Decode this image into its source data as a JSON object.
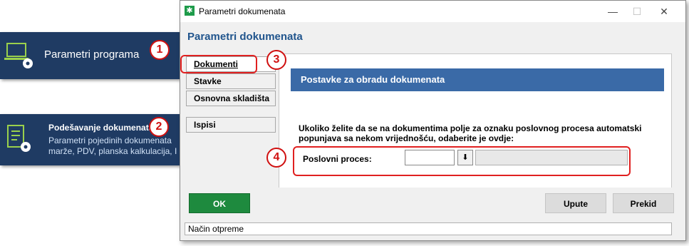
{
  "tiles": {
    "program_params": {
      "label": "Parametri programa"
    },
    "doc_settings": {
      "title": "Podešavanje dokumenata",
      "desc_line1": "Parametri pojedinih dokumenata",
      "desc_line2": "marže, PDV, planska kalkulacija, I"
    }
  },
  "callouts": [
    "1",
    "2",
    "3",
    "4"
  ],
  "window": {
    "title": "Parametri dokumenata",
    "page_title": "Parametri dokumenata",
    "controls": {
      "minimize": "—",
      "maximize": "☐",
      "close": "✕"
    }
  },
  "tabs": [
    {
      "label": "Dokumenti",
      "active": true
    },
    {
      "label": "Stavke",
      "active": false
    },
    {
      "label": "Osnovna skladišta",
      "active": false
    },
    {
      "label": "Ispisi",
      "active": false
    }
  ],
  "panel": {
    "banner": "Postavke za obradu dokumenata",
    "instruction_line1": "Ukoliko želite da se na dokumentima polje za oznaku poslovnog procesa automatski",
    "instruction_line2": "popunjava sa nekom vrijednošću, odaberite je ovdje:",
    "field_label": "Poslovni proces:",
    "field_value": "",
    "field_description": ""
  },
  "buttons": {
    "ok": "OK",
    "help": "Upute",
    "cancel": "Prekid"
  },
  "status_bar": "Način otpreme",
  "colors": {
    "accent": "#1f3b63",
    "banner": "#3a6aa7",
    "ok": "#1e8a3e",
    "highlight": "#e02020"
  }
}
